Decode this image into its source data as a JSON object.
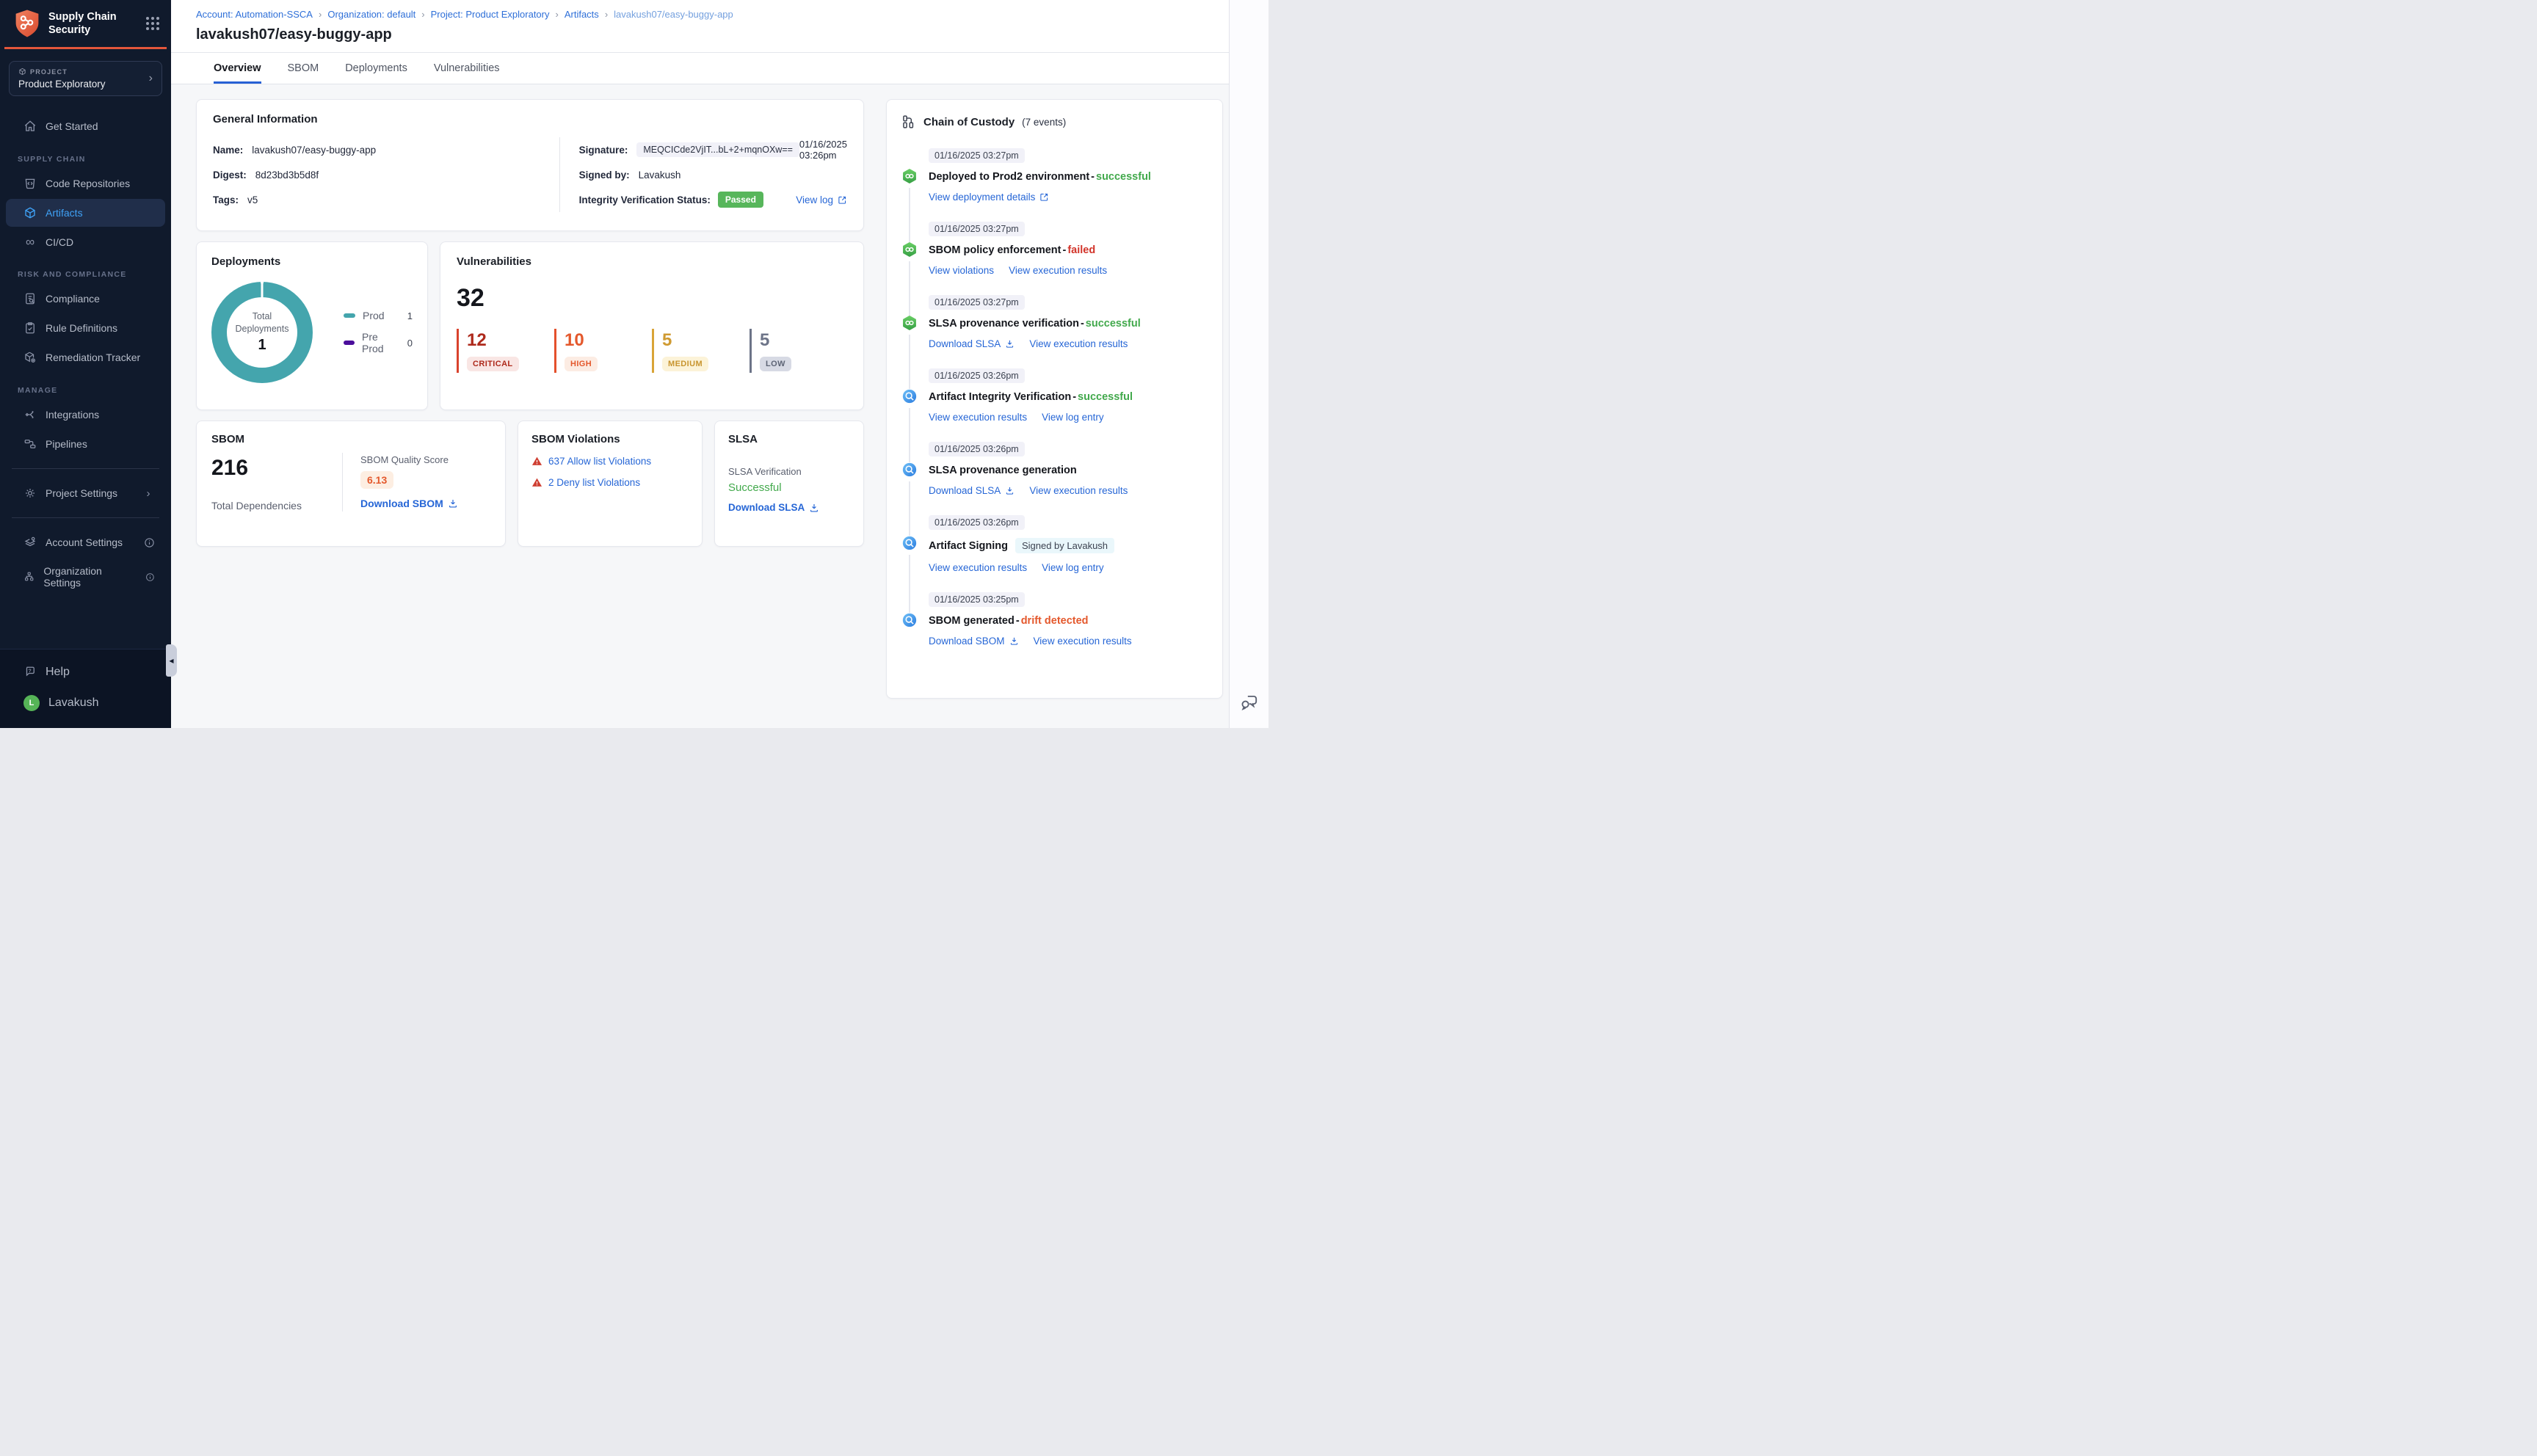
{
  "ui": {
    "chevron": "›",
    "collapse_glyph": "◀",
    "infinity_glyph": "∞"
  },
  "colors": {
    "sidebar_bg": "#101a2c",
    "accent_orange": "#e4563b",
    "link_blue": "#2666d6",
    "active_blue": "#3fa2f7",
    "teal": "#44a5ad",
    "purple": "#4b0e9b",
    "green": "#42a94c",
    "red": "#d2342a",
    "orange": "#e4582c",
    "critical": "#ae2a1c",
    "high": "#e4582c",
    "medium": "#c8952f",
    "low": "#5d6475"
  },
  "sidebar": {
    "app_title": "Supply Chain Security",
    "project": {
      "label": "PROJECT",
      "name": "Product Exploratory"
    },
    "get_started": "Get Started",
    "groups": [
      {
        "header": "SUPPLY CHAIN",
        "items": [
          "Code Repositories",
          "Artifacts",
          "CI/CD"
        ]
      },
      {
        "header": "RISK AND COMPLIANCE",
        "items": [
          "Compliance",
          "Rule Definitions",
          "Remediation Tracker"
        ]
      },
      {
        "header": "MANAGE",
        "items": [
          "Integrations",
          "Pipelines"
        ]
      }
    ],
    "project_settings": "Project Settings",
    "account_settings": "Account Settings",
    "organization_settings": "Organization Settings",
    "help": "Help",
    "user": {
      "name": "Lavakush",
      "initial": "L"
    }
  },
  "breadcrumb": {
    "separator": "›",
    "items": [
      "Account: Automation-SSCA",
      "Organization: default",
      "Project: Product Exploratory",
      "Artifacts",
      "lavakush07/easy-buggy-app"
    ]
  },
  "header": {
    "title": "lavakush07/easy-buggy-app"
  },
  "tabs": [
    "Overview",
    "SBOM",
    "Deployments",
    "Vulnerabilities"
  ],
  "general": {
    "title": "General Information",
    "name_label": "Name:",
    "name": "lavakush07/easy-buggy-app",
    "digest_label": "Digest:",
    "digest": "8d23bd3b5d8f",
    "tags_label": "Tags:",
    "tags": "v5",
    "signature_label": "Signature:",
    "signature": "MEQCICde2VjIT...bL+2+mqnOXw==",
    "signature_date": "01/16/2025 03:26pm",
    "signed_by_label": "Signed by:",
    "signed_by": "Lavakush",
    "integrity_label": "Integrity Verification Status:",
    "integrity_status": "Passed",
    "view_log": "View log"
  },
  "deployments": {
    "title": "Deployments",
    "center_label": "Total Deployments",
    "total": "1",
    "legend": [
      {
        "label": "Prod",
        "value": "1",
        "color": "#44a5ad"
      },
      {
        "label": "Pre Prod",
        "value": "0",
        "color": "#4b0e9b"
      }
    ],
    "chart": {
      "type": "donut",
      "series": [
        {
          "name": "Prod",
          "value": 1
        },
        {
          "name": "Pre Prod",
          "value": 0
        }
      ]
    }
  },
  "vulnerabilities": {
    "title": "Vulnerabilities",
    "total": "32",
    "items": [
      {
        "count": "12",
        "label": "CRITICAL"
      },
      {
        "count": "10",
        "label": "HIGH"
      },
      {
        "count": "5",
        "label": "MEDIUM"
      },
      {
        "count": "5",
        "label": "LOW"
      }
    ]
  },
  "sbom": {
    "title": "SBOM",
    "total": "216",
    "total_label": "Total Dependencies",
    "quality_label": "SBOM Quality Score",
    "quality_score": "6.13",
    "download": "Download SBOM"
  },
  "violations": {
    "title": "SBOM Violations",
    "items": [
      "637 Allow list Violations",
      "2 Deny list Violations"
    ]
  },
  "slsa": {
    "title": "SLSA",
    "verification_label": "SLSA Verification",
    "status": "Successful",
    "download": "Download SLSA"
  },
  "chain": {
    "title": "Chain of Custody",
    "count": "(7 events)",
    "events": [
      {
        "time": "01/16/2025 03:27pm",
        "title": "Deployed to Prod2 environment",
        "sep": " - ",
        "status": "successful",
        "links": [
          {
            "label": "View deployment details",
            "icon": "external"
          }
        ]
      },
      {
        "time": "01/16/2025 03:27pm",
        "title": "SBOM policy enforcement",
        "sep": " - ",
        "status": "failed",
        "links": [
          {
            "label": "View violations"
          },
          {
            "label": "View execution results"
          }
        ]
      },
      {
        "time": "01/16/2025 03:27pm",
        "title": "SLSA provenance verification",
        "sep": " - ",
        "status": "successful",
        "links": [
          {
            "label": "Download SLSA",
            "icon": "download"
          },
          {
            "label": "View execution results"
          }
        ]
      },
      {
        "time": "01/16/2025 03:26pm",
        "title": "Artifact Integrity Verification",
        "sep": " - ",
        "status": "successful",
        "links": [
          {
            "label": "View execution results"
          },
          {
            "label": "View log entry"
          }
        ]
      },
      {
        "time": "01/16/2025 03:26pm",
        "title": "SLSA provenance generation",
        "links": [
          {
            "label": "Download SLSA",
            "icon": "download"
          },
          {
            "label": "View execution results"
          }
        ]
      },
      {
        "time": "01/16/2025 03:26pm",
        "title": "Artifact Signing",
        "badge": "Signed by Lavakush",
        "links": [
          {
            "label": "View execution results"
          },
          {
            "label": "View log entry"
          }
        ]
      },
      {
        "time": "01/16/2025 03:25pm",
        "title": "SBOM generated",
        "sep": " - ",
        "status": "drift detected",
        "links": [
          {
            "label": "Download SBOM",
            "icon": "download"
          },
          {
            "label": "View execution results"
          }
        ]
      }
    ]
  }
}
